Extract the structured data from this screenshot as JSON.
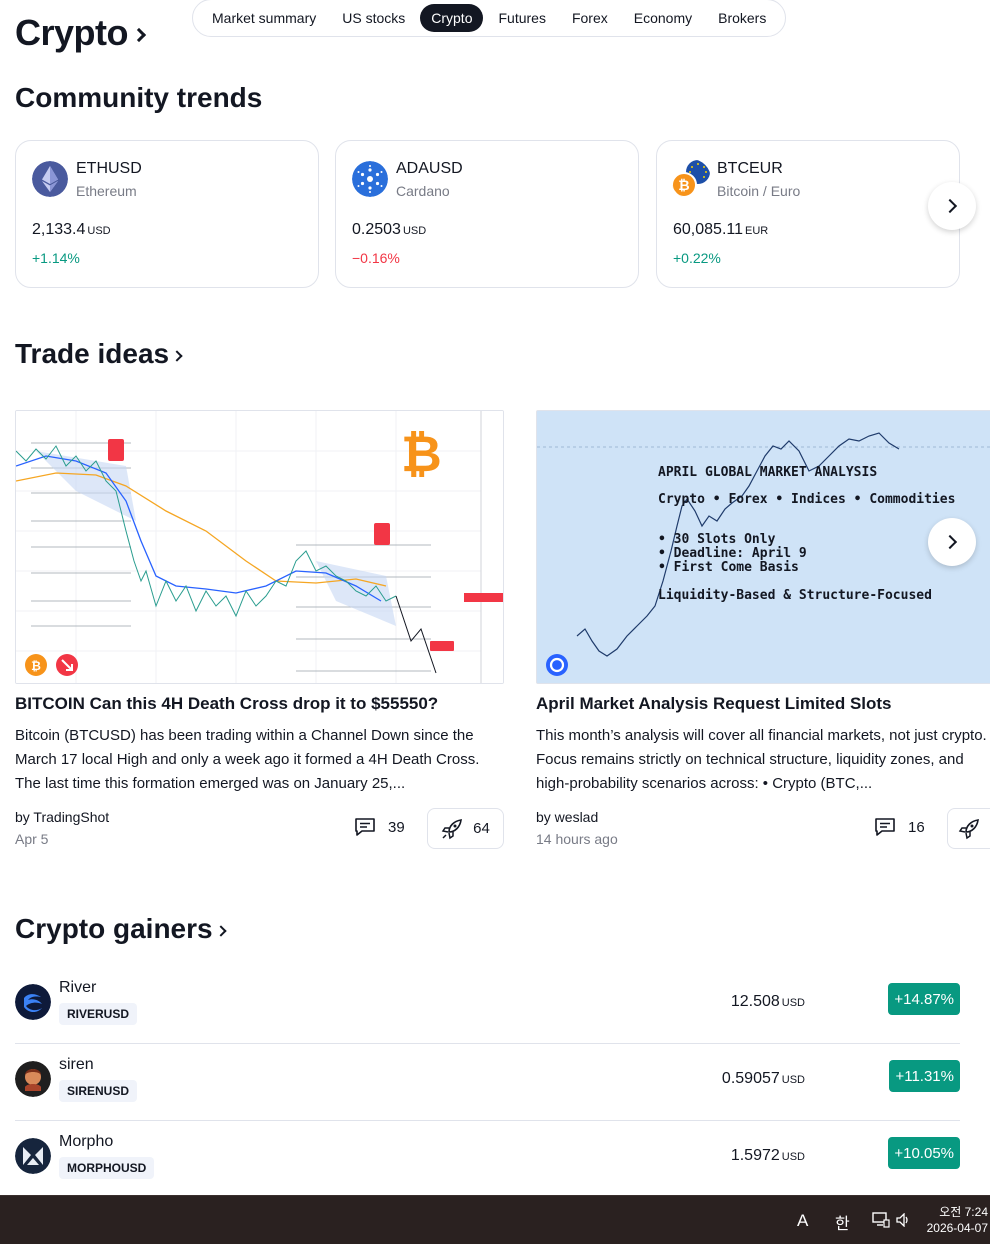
{
  "header": {
    "title": "Crypto",
    "tabs": [
      {
        "label": "Market summary",
        "active": false
      },
      {
        "label": "US stocks",
        "active": false
      },
      {
        "label": "Crypto",
        "active": true
      },
      {
        "label": "Futures",
        "active": false
      },
      {
        "label": "Forex",
        "active": false
      },
      {
        "label": "Economy",
        "active": false
      },
      {
        "label": "Brokers",
        "active": false
      }
    ]
  },
  "community_trends": {
    "title": "Community trends",
    "cards": [
      {
        "symbol": "ETHUSD",
        "name": "Ethereum",
        "price": "2,133.4",
        "currency": "USD",
        "change": "+1.14%",
        "direction": "up",
        "icon": "ethereum-icon"
      },
      {
        "symbol": "ADAUSD",
        "name": "Cardano",
        "price": "0.2503",
        "currency": "USD",
        "change": "−0.16%",
        "direction": "down",
        "icon": "cardano-icon"
      },
      {
        "symbol": "BTCEUR",
        "name": "Bitcoin / Euro",
        "price": "60,085.11",
        "currency": "EUR",
        "change": "+0.22%",
        "direction": "up",
        "icon": "bitcoin-euro-icon"
      }
    ]
  },
  "trade_ideas": {
    "title": "Trade ideas",
    "ideas": [
      {
        "title": "BITCOIN Can this 4H Death Cross drop it to $55550?",
        "description": "Bitcoin (BTCUSD) has been trading within a Channel Down since the March 17 local High and only a week ago it formed a 4H Death Cross. The last time this formation emerged was on January 25,...",
        "author": "by TradingShot",
        "date": "Apr 5",
        "comments": "39",
        "boosts": "64"
      },
      {
        "title": "April Market Analysis Request Limited Slots",
        "description": "This month’s analysis will cover all financial markets, not just crypto. Focus remains strictly on technical structure, liquidity zones, and high-probability scenarios across: • Crypto (BTC,...",
        "author": "by weslad",
        "date": "14 hours ago",
        "comments": "16",
        "image_text": {
          "heading": "APRIL GLOBAL MARKET ANALYSIS",
          "markets": "Crypto • Forex • Indices • Commodities",
          "bullets": [
            "30 Slots Only",
            "Deadline: April 9",
            "First Come Basis"
          ],
          "footer": "Liquidity-Based & Structure-Focused"
        }
      }
    ]
  },
  "gainers": {
    "title": "Crypto gainers",
    "rows": [
      {
        "name": "River",
        "ticker": "RIVERUSD",
        "price": "12.508",
        "currency": "USD",
        "change": "+14.87%"
      },
      {
        "name": "siren",
        "ticker": "SIRENUSD",
        "price": "0.59057",
        "currency": "USD",
        "change": "+11.31%"
      },
      {
        "name": "Morpho",
        "ticker": "MORPHOUSD",
        "price": "1.5972",
        "currency": "USD",
        "change": "+10.05%"
      }
    ]
  },
  "taskbar": {
    "ime": "A",
    "lang": "한",
    "time": "오전 7:24",
    "date": "2026-04-07"
  },
  "colors": {
    "positive": "#089981",
    "negative": "#f23645",
    "text": "#131722",
    "muted": "#787b86"
  }
}
